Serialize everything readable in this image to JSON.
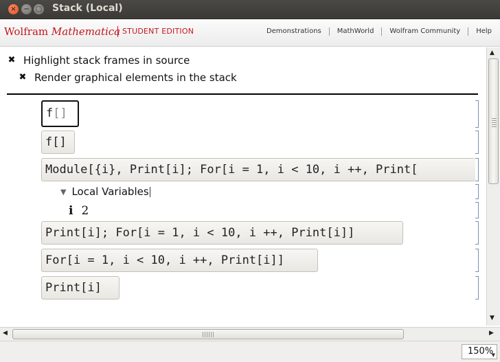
{
  "window": {
    "title": "Stack (Local)"
  },
  "header": {
    "brand_word": "Wolfram",
    "brand_product": "Mathematica",
    "edition": "STUDENT EDITION",
    "links": [
      "Demonstrations",
      "MathWorld",
      "Wolfram Community",
      "Help"
    ]
  },
  "options": {
    "highlight_label": "Highlight stack frames in source",
    "highlight_checked": true,
    "render_label": "Render graphical elements in the stack",
    "render_checked": true,
    "check_glyph": "✖"
  },
  "stack": {
    "frames": [
      {
        "head": "f",
        "args": "[]"
      },
      {
        "text": "f[]"
      },
      {
        "text": "Module[{i}, Print[i]; For[i = 1, i < 10, i ++, Print["
      },
      {
        "text": "Print[i]; For[i = 1, i < 10, i ++, Print[i]]"
      },
      {
        "text": "For[i = 1, i < 10, i ++, Print[i]]"
      },
      {
        "text": "Print[i]"
      }
    ],
    "local_variables_label": "Local Variables",
    "variables": [
      {
        "name": "i",
        "value": "2"
      }
    ]
  },
  "status": {
    "zoom": "150%"
  },
  "icons": {
    "close": "×",
    "minimize": "−",
    "maximize": "□",
    "up": "▲",
    "down": "▼",
    "left": "◀",
    "right": "▶",
    "triangle": "▼",
    "dropdown": "▼"
  },
  "colors": {
    "brand": "#c2161b",
    "titlebar": "#3c3b37",
    "close_button": "#e2531c"
  }
}
